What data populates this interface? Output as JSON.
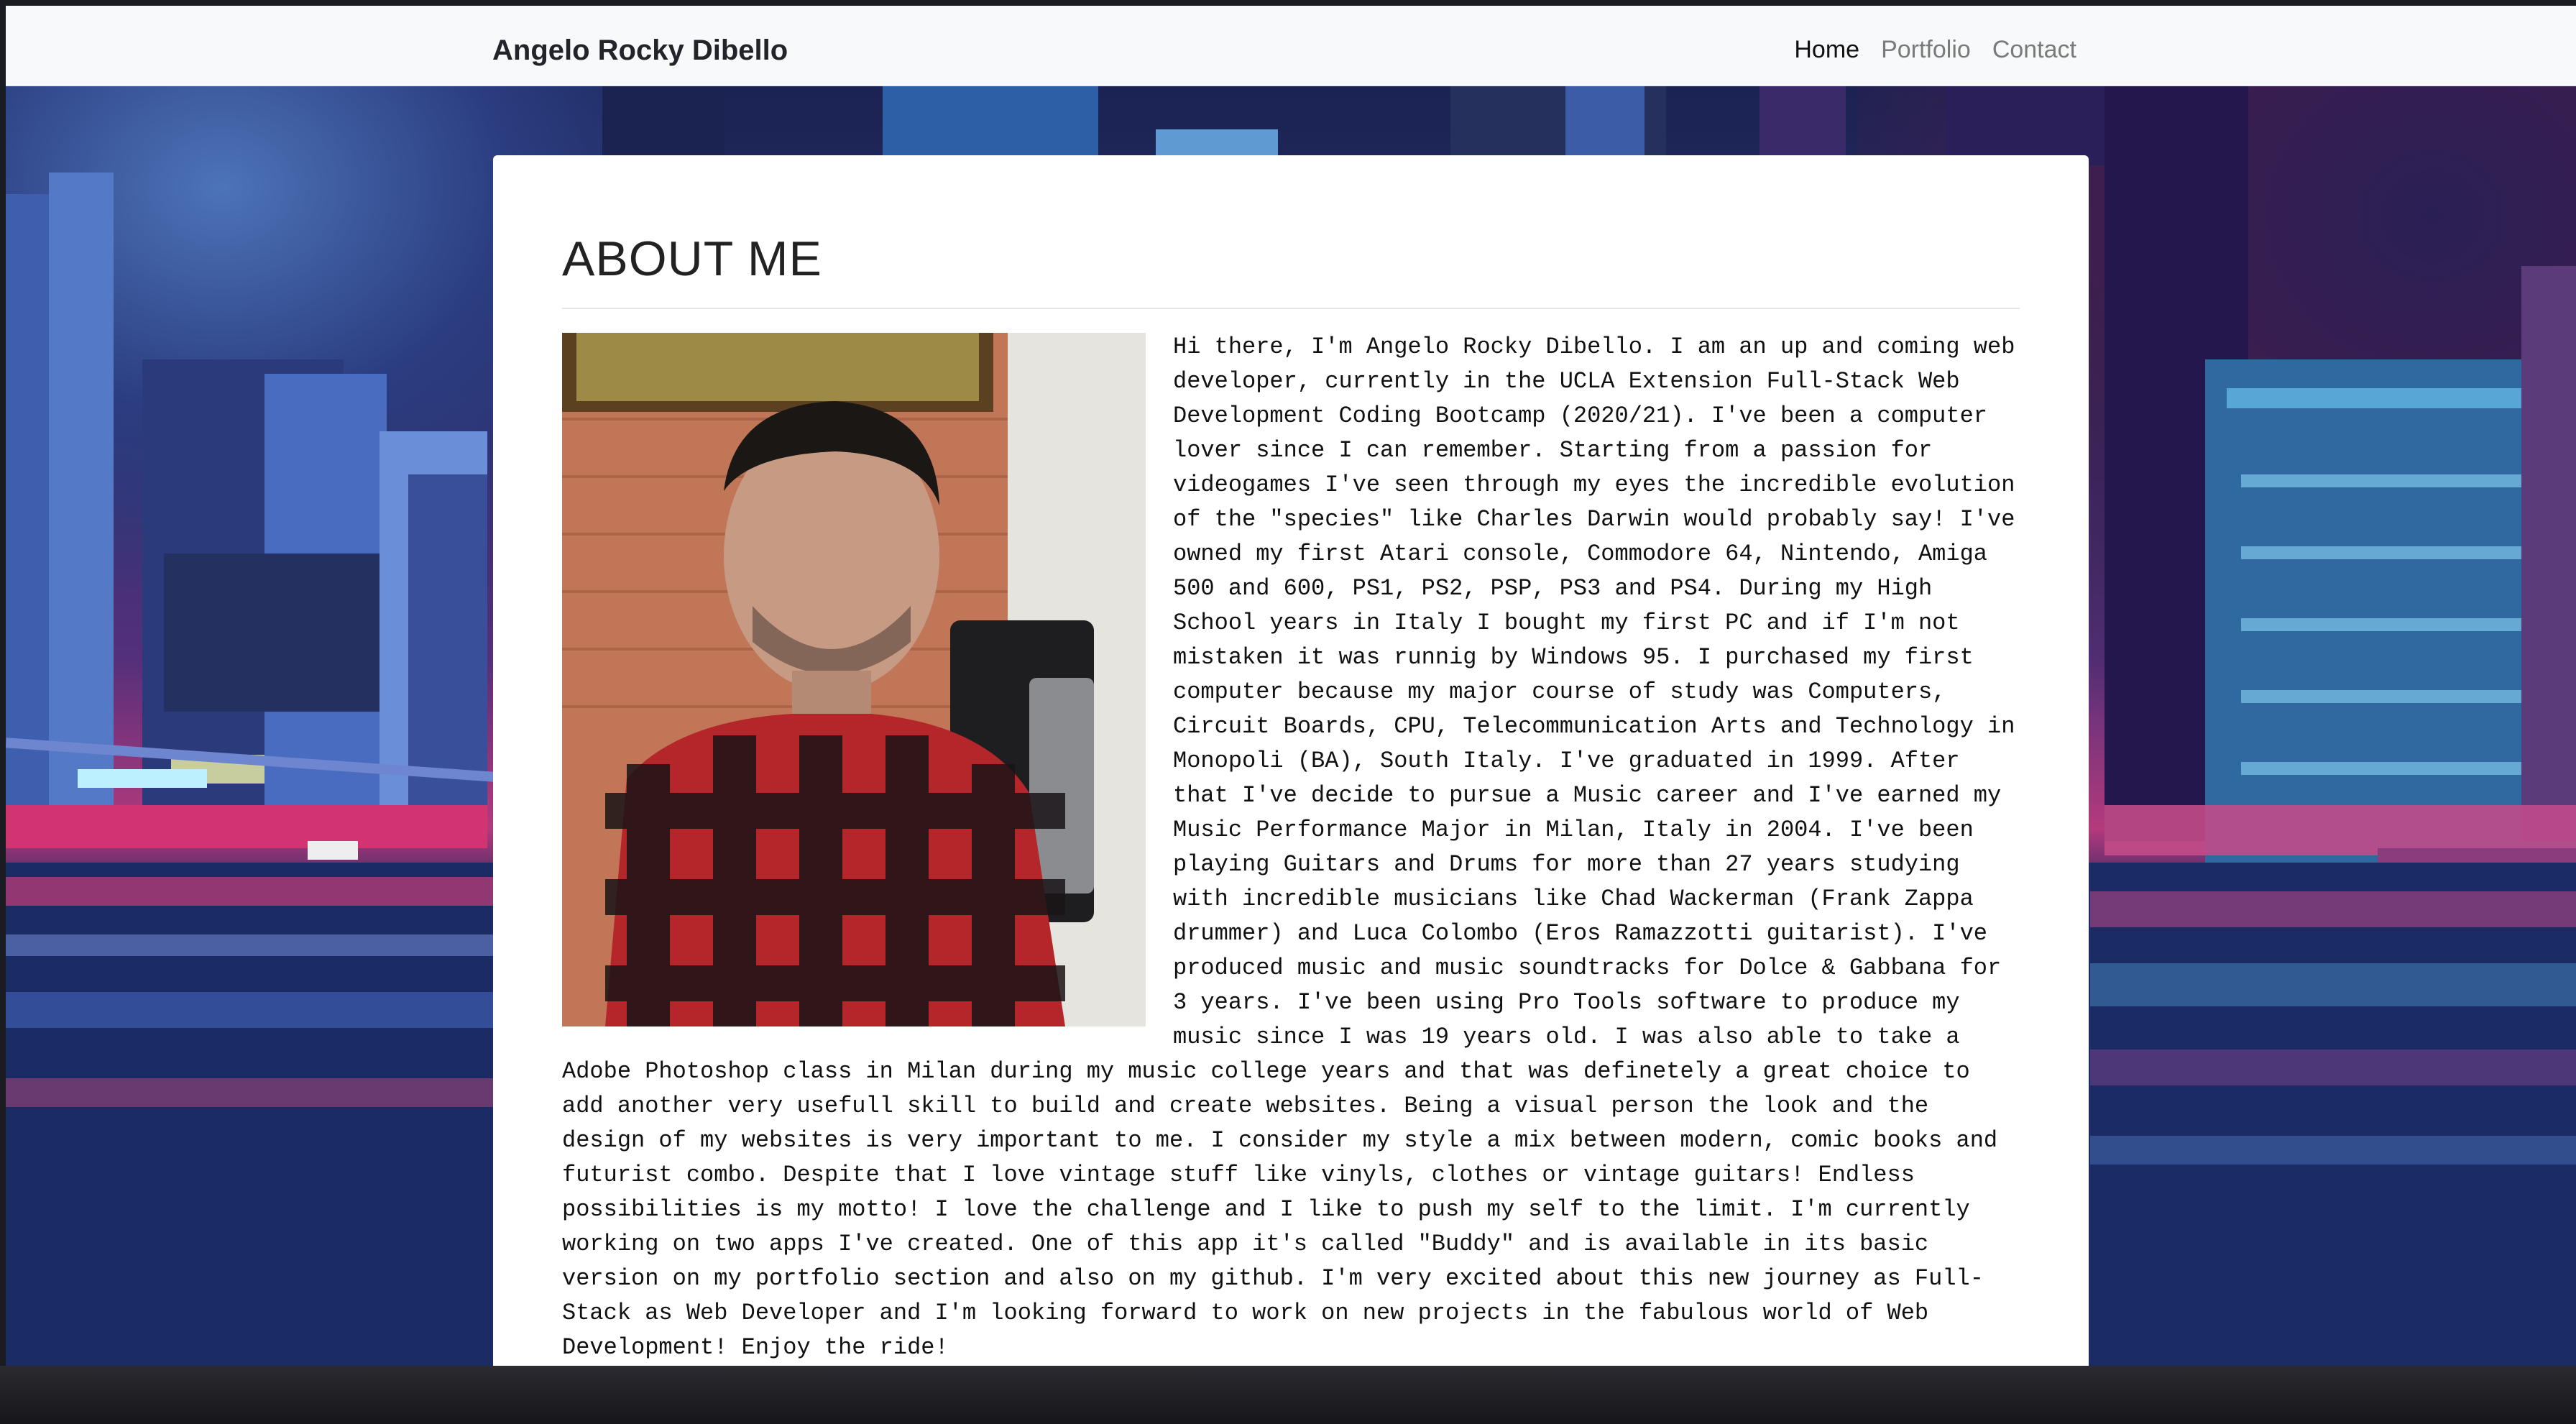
{
  "navbar": {
    "brand": "Angelo Rocky Dibello",
    "links": [
      {
        "label": "Home",
        "active": true
      },
      {
        "label": "Portfolio",
        "active": false
      },
      {
        "label": "Contact",
        "active": false
      }
    ]
  },
  "about": {
    "heading": "ABOUT ME",
    "bio": "Hi there, I'm Angelo Rocky Dibello. I am an up and coming web developer, currently in the UCLA Extension Full-Stack Web Development Coding Bootcamp (2020/21). I've been a computer lover since I can remember. Starting from a passion for videogames I've seen through my eyes the incredible evolution of the \"species\" like Charles Darwin would probably say! I've owned my first Atari console, Commodore 64, Nintendo, Amiga 500 and 600, PS1, PS2, PSP, PS3 and PS4. During my High School years in Italy I bought my first PC and if I'm not mistaken it was runnig by Windows 95. I purchased my first computer because my major course of study was Computers, Circuit Boards, CPU, Telecommunication Arts and Technology in Monopoli (BA), South Italy. I've graduated in 1999. After that I've decide to pursue a Music career and I've earned my Music Performance Major in Milan, Italy in 2004. I've been playing Guitars and Drums for more than 27 years studying with incredible musicians like Chad Wackerman (Frank Zappa drummer) and Luca Colombo (Eros Ramazzotti guitarist). I've produced music and music soundtracks for Dolce & Gabbana for 3 years. I've been using Pro Tools software to produce my music since I was 19 years old. I was also able to take a Adobe Photoshop class in Milan during my music college years and that was definetely a great choice to add another very usefull skill to build and create websites. Being a visual person the look and the design of my websites is very important to me. I consider my style a mix between modern, comic books and futurist combo. Despite that I love vintage stuff like vinyls, clothes or vintage guitars! Endless possibilities is my motto! I love the challenge and I like to push my self to the limit. I'm currently working on two apps I've created. One of this app it's called \"Buddy\" and is available in its basic version on my portfolio section and also on my github. I'm very excited about this new journey as Full-Stack as Web Developer and I'm looking forward to work on new projects in the fabulous world of Web Development! Enjoy the ride!"
  },
  "colors": {
    "navbar_bg": "#f8f9fa",
    "card_bg": "#ffffff",
    "text": "#111111",
    "nav_inactive": "#7a7a7a"
  }
}
